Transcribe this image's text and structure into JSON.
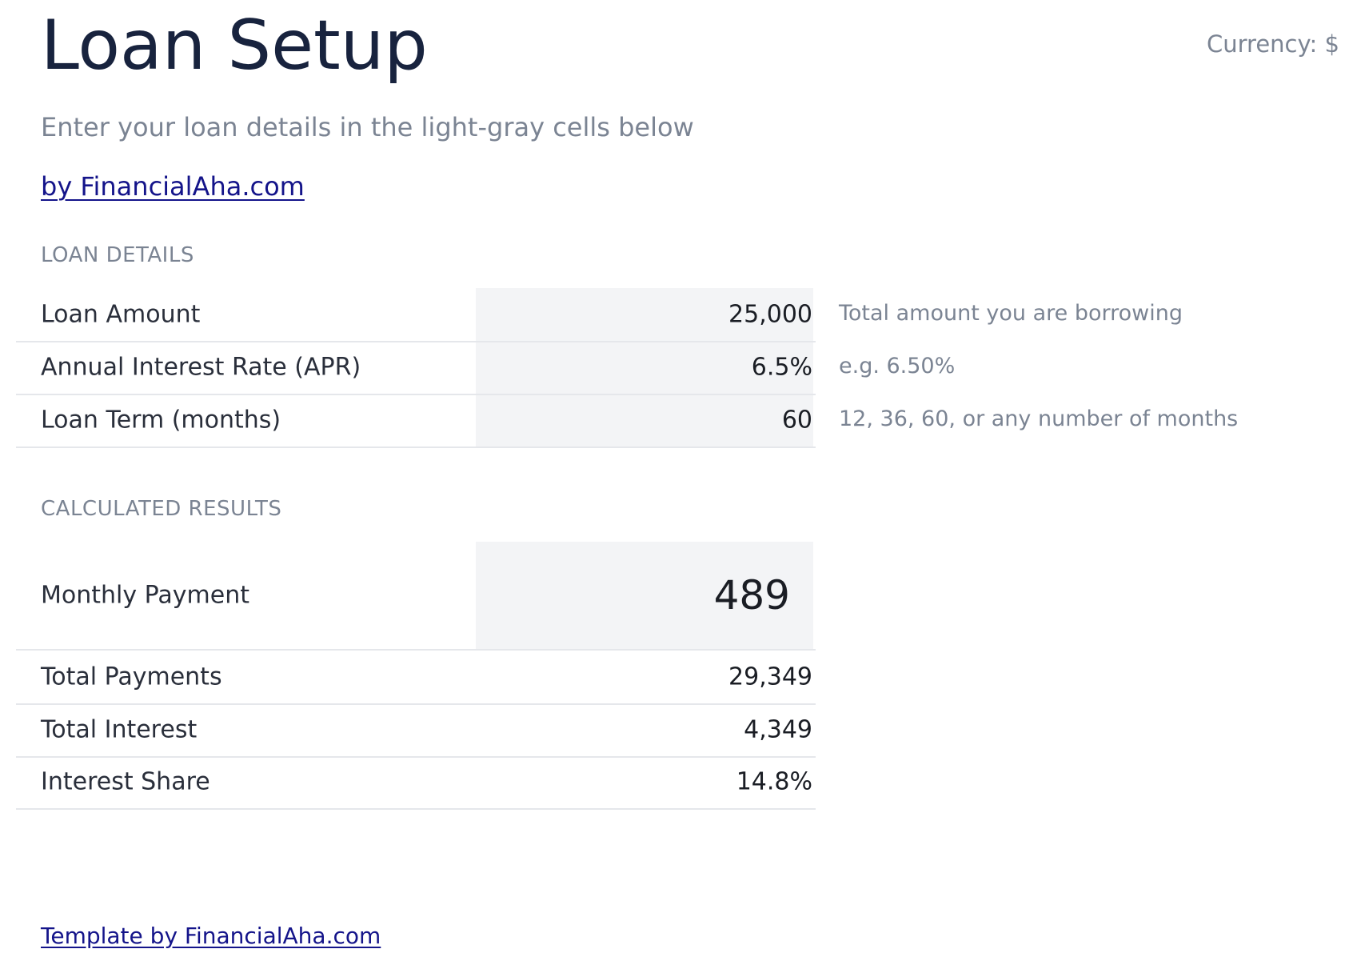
{
  "header": {
    "title": "Loan Setup",
    "currency": "Currency: $",
    "subtitle": "Enter your loan details in the light-gray cells below",
    "brand_link": "by FinancialAha.com"
  },
  "loan_details": {
    "section_label": "LOAN DETAILS",
    "rows": [
      {
        "label": "Loan Amount",
        "value": "25,000",
        "hint": "Total amount you are borrowing"
      },
      {
        "label": "Annual Interest Rate (APR)",
        "value": "6.5%",
        "hint": "e.g. 6.50%"
      },
      {
        "label": "Loan Term (months)",
        "value": "60",
        "hint": "12, 36, 60, or any number of months"
      }
    ]
  },
  "results": {
    "section_label": "CALCULATED RESULTS",
    "monthly_payment": {
      "label": "Monthly Payment",
      "value": "489"
    },
    "rows": [
      {
        "label": "Total Payments",
        "value": "29,349"
      },
      {
        "label": "Total Interest",
        "value": "4,349"
      },
      {
        "label": "Interest Share",
        "value": "14.8%"
      }
    ]
  },
  "footer": {
    "link": "Template by FinancialAha.com"
  },
  "colors": {
    "title": "#18233e",
    "muted_text": "#7b8493",
    "link": "#14148a",
    "input_cell_bg": "#f3f4f6",
    "divider": "#e5e7eb"
  }
}
